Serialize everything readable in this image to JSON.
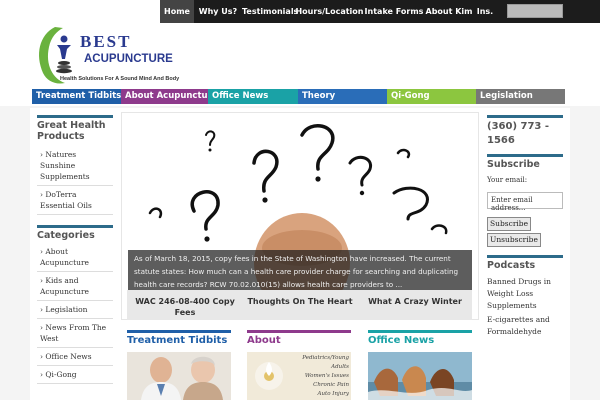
{
  "topnav": {
    "items": [
      "Home",
      "Why Us?",
      "Testimonials",
      "Hours/Location",
      "Intake Forms",
      "About Kim",
      "Ins."
    ],
    "active_index": 0
  },
  "brand": {
    "name_line1": "BEST",
    "name_line2": "ACUPUNCTURE",
    "tagline": "Health Solutions For A Sound Mind And Body",
    "color": "#2a3a8f"
  },
  "categories": [
    {
      "label": "Treatment Tidbits",
      "color": "#1f5fa8"
    },
    {
      "label": "About Acupuncture",
      "color": "#8e3a8c"
    },
    {
      "label": "Office News",
      "color": "#1aa2a6"
    },
    {
      "label": "Theory",
      "color": "#2a6db8"
    },
    {
      "label": "Qi-Gong",
      "color": "#8cc63f"
    },
    {
      "label": "Legislation",
      "color": "#777777"
    }
  ],
  "left_sidebar": {
    "products_title": "Great Health Products",
    "products": [
      "Natures Sunshine Supplements",
      "DoTerra Essential Oils"
    ],
    "categories_title": "Categories",
    "categories": [
      "About Acupuncture",
      "Kids and Acupuncture",
      "Legislation",
      "News From The West",
      "Office News",
      "Qi-Gong"
    ]
  },
  "hero": {
    "caption": "As of March 18, 2015, copy fees in the State of Washington have increased.  The current statute states: How much can a health care provider charge for searching and duplicating health care records? RCW 70.02.010(15) allows health care providers to ...",
    "tabs": [
      "WAC 246-08-400 Copy Fees",
      "Thoughts On The Heart",
      "What A Crazy Winter"
    ]
  },
  "bottom": {
    "col1": {
      "title": "Treatment Tidbits",
      "color": "#1f5fa8"
    },
    "col2": {
      "title": "About Acupuncture",
      "color": "#8e3a8c",
      "poster_lines": [
        "Pediatrics/Young Adults",
        "Women's Issues",
        "Chronic Pain",
        "Auto Injury"
      ]
    },
    "col3": {
      "title": "Office News",
      "color": "#1aa2a6"
    }
  },
  "right_sidebar": {
    "phone": "(360) 773 - 1566",
    "subscribe_title": "Subscribe",
    "email_label": "Your email:",
    "email_placeholder": "Enter email address...",
    "subscribe_button": "Subscribe",
    "unsubscribe_button": "Unsubscribe",
    "podcasts_title": "Podcasts",
    "podcasts": [
      "Banned Drugs in Weight Loss Supplements",
      "E-cigarettes and Formaldehyde"
    ]
  }
}
